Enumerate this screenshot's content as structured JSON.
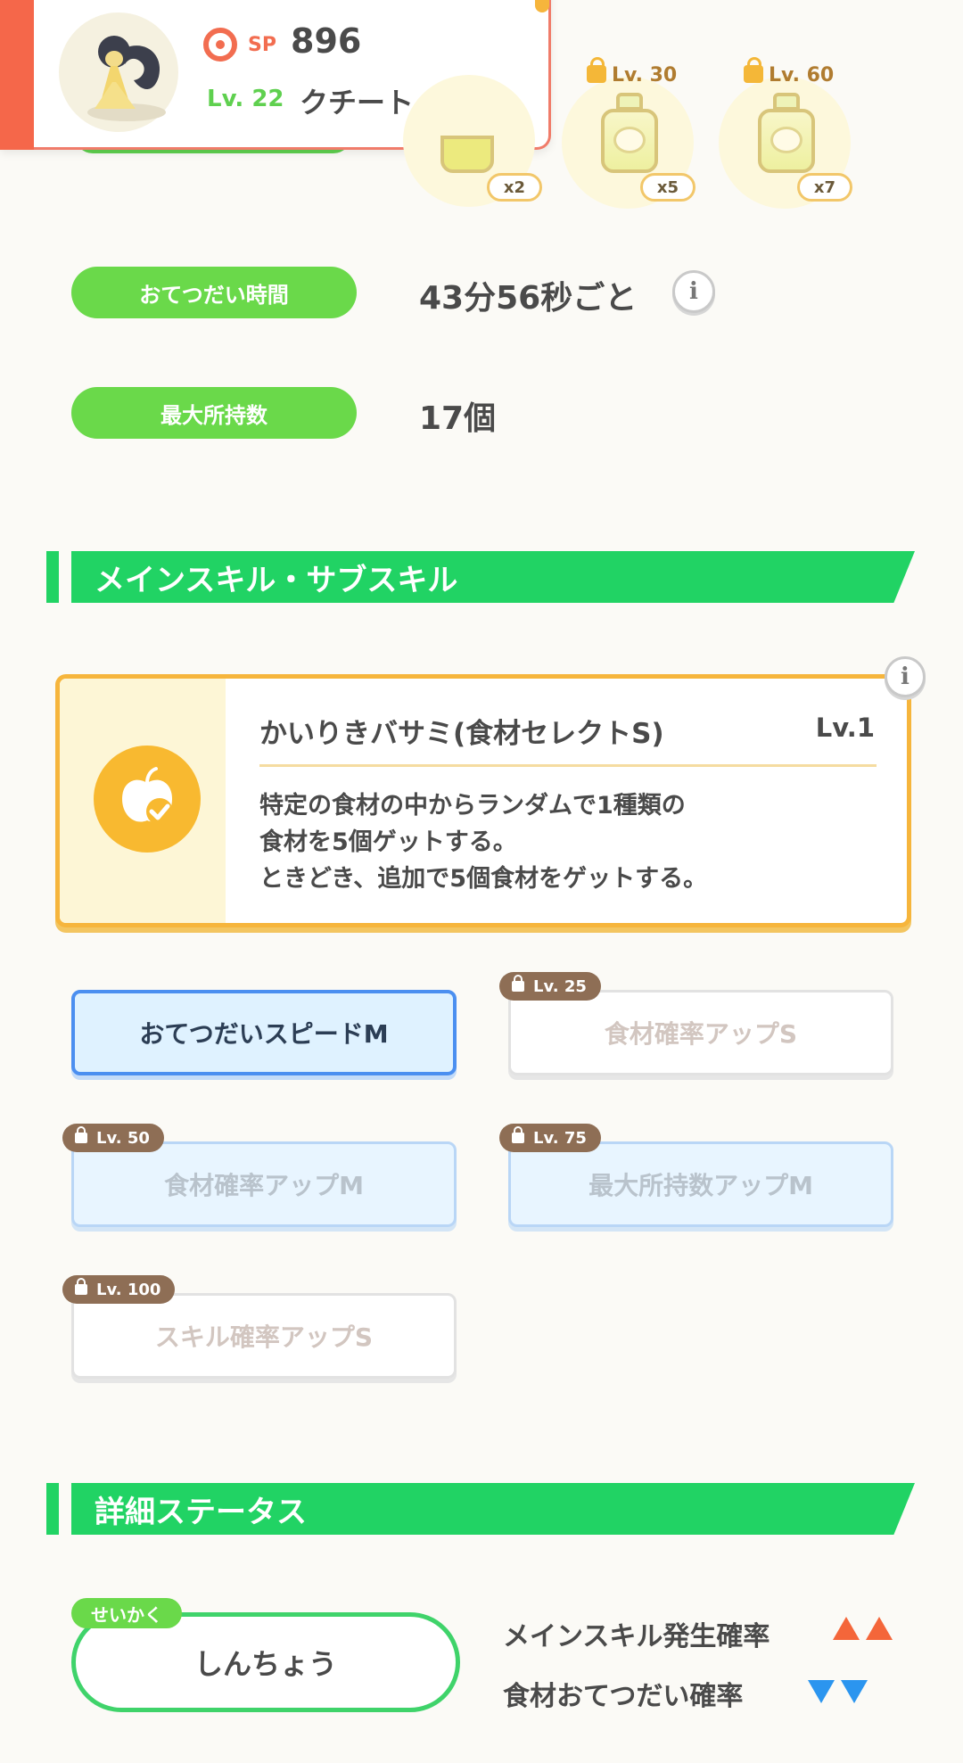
{
  "header": {
    "sp_label": "SP",
    "sp_value": "896",
    "level": "Lv. 22",
    "pokemon_name": "クチート"
  },
  "ingredients": [
    {
      "quantity": "x2",
      "unlock": ""
    },
    {
      "quantity": "x5",
      "unlock": "Lv. 30"
    },
    {
      "quantity": "x7",
      "unlock": "Lv. 60"
    }
  ],
  "stats": {
    "help_time_label": "おてつだい時間",
    "help_time_value": "43分56秒ごと",
    "max_carry_label": "最大所持数",
    "max_carry_value": "17個"
  },
  "skills_section": {
    "title": "メインスキル・サブスキル",
    "main_skill": {
      "name": "かいりきバサミ(食材セレクトS)",
      "level": "Lv.1",
      "description": [
        "特定の食材の中からランダムで1種類の",
        "食材を5個ゲットする。",
        "ときどき、追加で5個食材をゲットする。"
      ]
    },
    "sub_skills": [
      {
        "label": "おてつだいスピードM",
        "unlock": "",
        "state": "active"
      },
      {
        "label": "食材確率アップS",
        "unlock": "Lv. 25",
        "state": "locked"
      },
      {
        "label": "食材確率アップM",
        "unlock": "Lv. 50",
        "state": "locked"
      },
      {
        "label": "最大所持数アップM",
        "unlock": "Lv. 75",
        "state": "locked"
      },
      {
        "label": "スキル確率アップS",
        "unlock": "Lv. 100",
        "state": "locked"
      }
    ]
  },
  "details_section": {
    "title": "詳細ステータス",
    "nature_tag": "せいかく",
    "nature_value": "しんちょう",
    "effects": [
      {
        "label": "メインスキル発生確率",
        "direction": "up"
      },
      {
        "label": "食材おてつだい確率",
        "direction": "down"
      }
    ]
  },
  "colors": {
    "accent_green": "#21d364",
    "pill_green": "#6ad94a",
    "header_red": "#f5674a",
    "skill_gold": "#f6b53c",
    "sub_active_blue": "#4b8ff0",
    "up_arrow": "#f4663a",
    "down_arrow": "#2b95ef"
  },
  "icons": {
    "sp": "pokeball-icon",
    "info": "info-icon",
    "lock": "lock-icon",
    "skill": "apple-check-icon",
    "ingredient": "honey-jar-icon"
  }
}
